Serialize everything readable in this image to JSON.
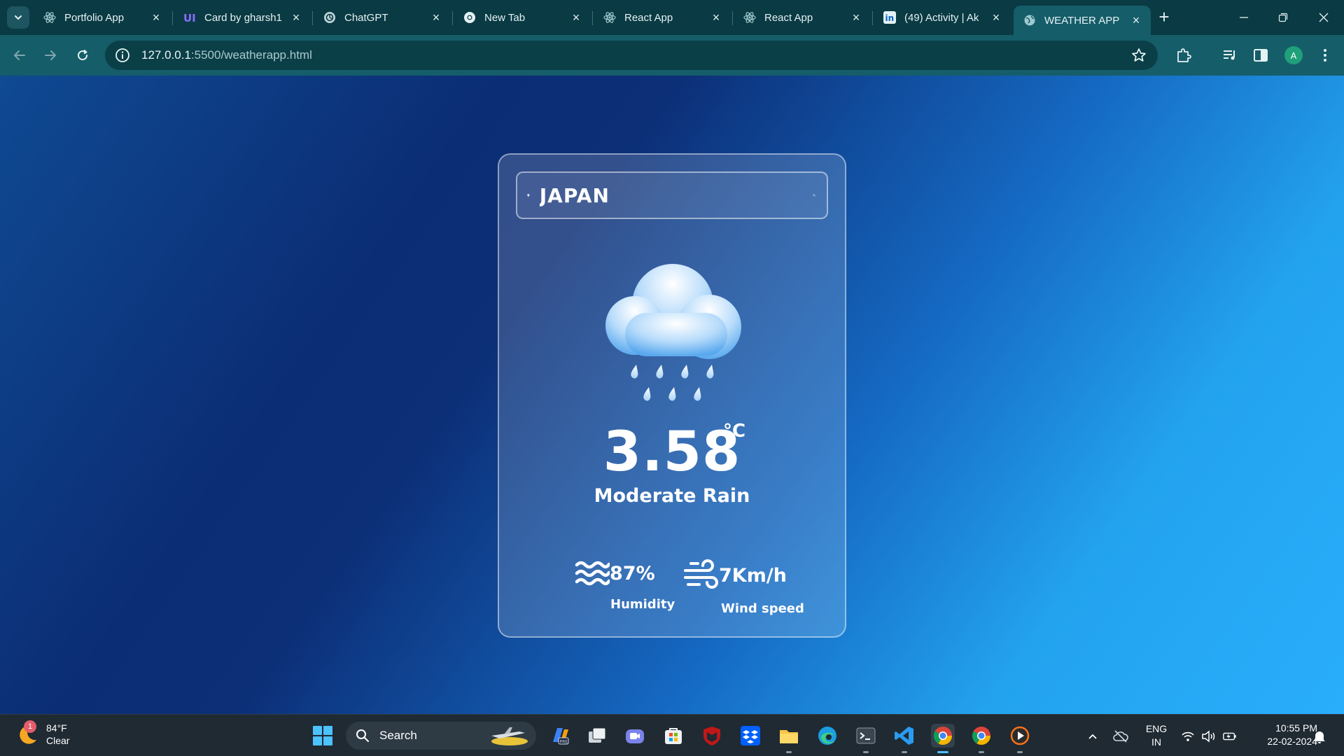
{
  "browser": {
    "tabs": [
      {
        "title": "Portfolio App",
        "icon": "react-icon"
      },
      {
        "title": "Card by gharsh1",
        "icon": "uiverse-icon"
      },
      {
        "title": "ChatGPT",
        "icon": "chatgpt-icon"
      },
      {
        "title": "New Tab",
        "icon": "chrome-icon"
      },
      {
        "title": "React App",
        "icon": "react-icon"
      },
      {
        "title": "React App",
        "icon": "react-icon"
      },
      {
        "title": "(49) Activity | Ak",
        "icon": "linkedin-icon"
      },
      {
        "title": "WEATHER APP",
        "icon": "globe-icon",
        "active": true
      }
    ],
    "url_host": "127.0.0.1",
    "url_path": ":5500/weatherapp.html",
    "profile_initial": "A"
  },
  "weather": {
    "city": "JAPAN",
    "temperature": "3.58",
    "unit": "°C",
    "description": "Moderate Rain",
    "humidity_value": "87%",
    "humidity_label": "Humidity",
    "wind_value": "7Km/h",
    "wind_label": "Wind speed",
    "icon": "rain-cloud-icon"
  },
  "taskbar": {
    "weather_badge": "1",
    "weather_temp": "84°F",
    "weather_text": "Clear",
    "search_label": "Search",
    "lang_top": "ENG",
    "lang_bottom": "IN",
    "time": "10:55 PM",
    "date": "22-02-2024"
  },
  "colors": {
    "page_gradient_dark": "#0b2d75",
    "page_gradient_light": "#29aefc",
    "browser_frame": "#0a3a43",
    "toolbar": "#155d69",
    "taskbar": "#1f2a33"
  }
}
